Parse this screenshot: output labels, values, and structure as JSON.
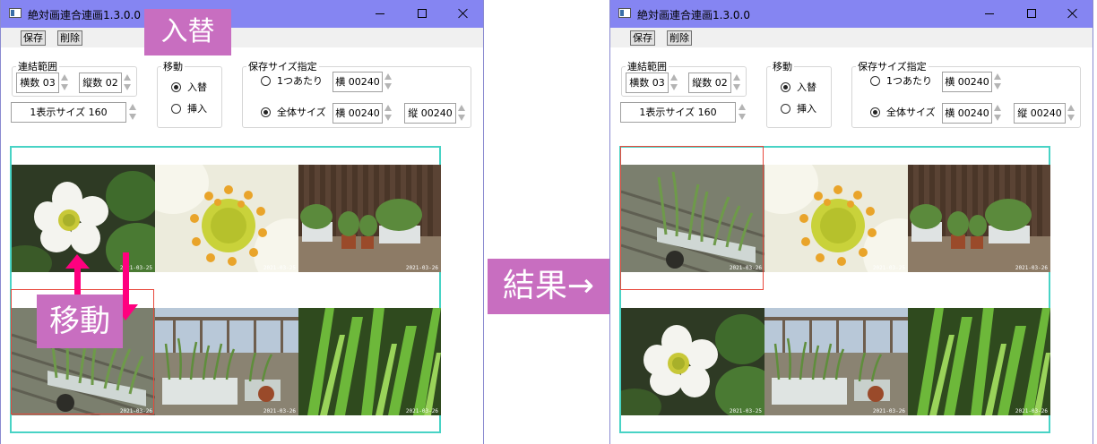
{
  "app": {
    "title": "絶対画連合連画1.3.0.0"
  },
  "menu": {
    "save_label": "保存",
    "delete_label": "削除"
  },
  "controls": {
    "link_range_label": "連結範囲",
    "horizontal_count": "横数 03",
    "vertical_count": "縦数 02",
    "display_size": "1表示サイズ 160",
    "move_label": "移動",
    "swap_label": "入替",
    "insert_label": "挿入",
    "save_size_label": "保存サイズ指定",
    "per_one_label": "1つあたり",
    "per_one_width": "横 00240",
    "total_label": "全体サイズ",
    "total_width": "横 00240",
    "total_height": "縦 00240"
  },
  "photos": {
    "date_a": "2021-03-25",
    "date_b": "2021-03-26"
  },
  "annotations": {
    "swap_banner": "入替",
    "move_banner": "移動",
    "result_banner": "結果→"
  },
  "colors": {
    "titlebar": "#8585f2",
    "canvas_border": "#48d3c5",
    "selection": "#e8483c",
    "banner": "#c86ec0",
    "arrow": "#ff007f"
  }
}
